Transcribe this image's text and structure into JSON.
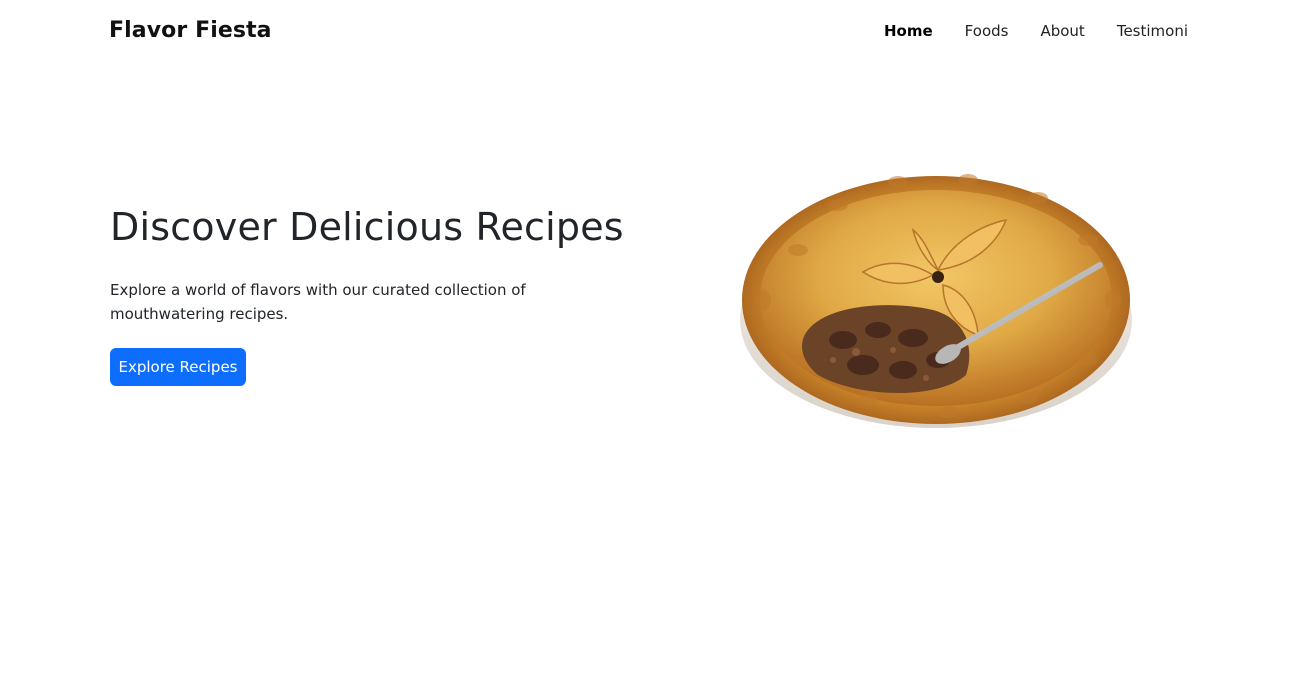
{
  "brand": {
    "name": "Flavor Fiesta"
  },
  "nav": {
    "items": [
      {
        "label": "Home",
        "active": true
      },
      {
        "label": "Foods",
        "active": false
      },
      {
        "label": "About",
        "active": false
      },
      {
        "label": "Testimoni",
        "active": false
      }
    ]
  },
  "hero": {
    "title": "Discover Delicious Recipes",
    "text": "Explore a world of flavors with our curated collection of mouthwatering recipes.",
    "button_label": "Explore Recipes",
    "image_subject": "pie-with-spoon-image"
  },
  "colors": {
    "accent": "#0d6efd",
    "text": "#212529",
    "background": "#ffffff",
    "crust": "#d99a3a",
    "filling": "#4a2a1c"
  }
}
